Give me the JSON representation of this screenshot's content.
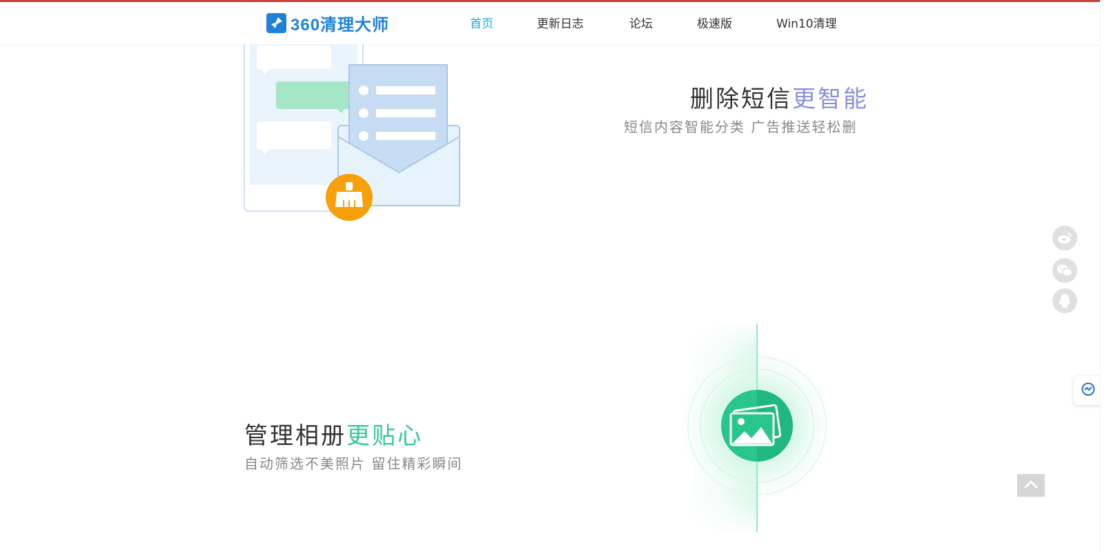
{
  "header": {
    "logo_text": "360清理大师",
    "nav": [
      {
        "label": "首页",
        "active": true
      },
      {
        "label": "更新日志",
        "active": false
      },
      {
        "label": "论坛",
        "active": false
      },
      {
        "label": "极速版",
        "active": false
      },
      {
        "label": "Win10清理",
        "active": false
      }
    ]
  },
  "features": [
    {
      "title_plain": "删除短信",
      "title_highlight": "更智能",
      "subtitle": "短信内容智能分类  广告推送轻松删",
      "icon": "sms-clean-illustration"
    },
    {
      "title_plain": "管理相册",
      "title_highlight": "更贴心",
      "subtitle": "自动筛选不美照片  留住精彩瞬间",
      "icon": "photo-album-illustration"
    }
  ],
  "sidebar": {
    "social_icons": [
      "weibo-icon",
      "wechat-icon",
      "qq-icon"
    ],
    "floating_tab_icon": "sync-icon",
    "back_to_top_icon": "chevron-up-icon"
  },
  "colors": {
    "accent_blue": "#1da8d8",
    "brand_blue": "#1f82d8",
    "highlight_purple": "#8a8fd8",
    "highlight_green": "#37c79a",
    "badge_orange": "#f7a10a"
  }
}
